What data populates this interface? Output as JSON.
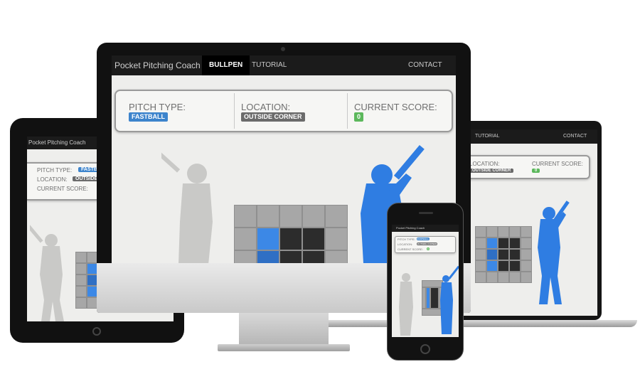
{
  "app": {
    "title": "Pocket Pitching Coach",
    "nav": {
      "bullpen": "BULLPEN",
      "tutorial": "TUTORIAL",
      "contact": "CONTACT"
    }
  },
  "status": {
    "pitch_type_label": "PITCH TYPE:",
    "pitch_type_value": "FASTBALL",
    "location_label": "LOCATION:",
    "location_value": "OUTSIDE CORNER",
    "score_label": "CURRENT SCORE:",
    "score_value": "0"
  },
  "laptop": {
    "nav_tutorial": "TUTORIAL",
    "nav_contact": "CONTACT",
    "location_label": "LOCATION:",
    "location_value": "OUTSIDE CORNER",
    "score_label": "CURRENT SCORE:",
    "score_value": "0"
  },
  "tablet": {
    "title": "Pocket Pitching Coach",
    "pitch_type_label": "PITCH TYPE:",
    "pitch_type_value": "FASTBA",
    "location_label": "LOCATION:",
    "location_value": "OUTSIDE",
    "score_label": "CURRENT SCORE:"
  },
  "colors": {
    "accent_blue": "#3d84cc",
    "zone_blue": "#3c88e6",
    "score_green": "#5cb85c",
    "navbar": "#1b1b1b"
  }
}
